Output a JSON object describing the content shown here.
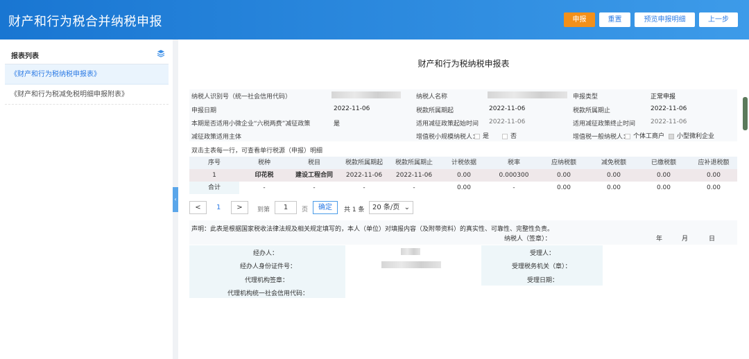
{
  "header": {
    "title": "财产和行为税合并纳税申报",
    "buttons": {
      "declare": "申报",
      "reset": "重置",
      "preview": "预览申报明细",
      "back": "上一步"
    }
  },
  "sidebar": {
    "title": "报表列表",
    "items": [
      "《财产和行为税纳税申报表》",
      "《财产和行为税减免税明细申报附表》"
    ]
  },
  "form": {
    "title": "财产和行为税纳税申报表",
    "taxpayer_id_label": "纳税人识别号（统一社会信用代码）",
    "taxpayer_name_label": "纳税人名称",
    "report_type_label": "申报类型",
    "report_type_value": "正常申报",
    "report_date_label": "申报日期",
    "report_date_value": "2022-11-06",
    "period_start_label": "税款所属期起",
    "period_start_value": "2022-11-06",
    "period_end_label": "税款所属期止",
    "period_end_value": "2022-11-06",
    "six_tax_label": "本期是否适用小微企业“六税两费”减征政策",
    "six_tax_value": "是",
    "policy_start_label": "适用减征政策起始时间",
    "policy_start_value": "2022-11-06",
    "policy_end_label": "适用减征政策终止时间",
    "policy_end_value": "2022-11-06",
    "policy_subject_label": "减征政策适用主体",
    "small_scale_label": "增值税小规模纳税人：",
    "yes": "是",
    "no": "否",
    "general_label": "增值税一般纳税人：",
    "individual": "个体工商户",
    "small_micro": "小型微利企业",
    "hint": "双击主表每一行，可查看单行税源（申报）明细"
  },
  "table": {
    "headers": [
      "序号",
      "税种",
      "税目",
      "税款所属期起",
      "税款所属期止",
      "计税依据",
      "税率",
      "应纳税额",
      "减免税额",
      "已缴税额",
      "应补退税额"
    ],
    "rows": [
      [
        "1",
        "印花税",
        "建设工程合同",
        "2022-11-06",
        "2022-11-06",
        "0.00",
        "0.000300",
        "0.00",
        "0.00",
        "0.00",
        "0.00"
      ]
    ],
    "total": [
      "合计",
      "-",
      "-",
      "-",
      "-",
      "0.00",
      "-",
      "0.00",
      "0.00",
      "0.00",
      "0.00"
    ]
  },
  "pagination": {
    "prev": "<",
    "current": "1",
    "next": ">",
    "goto_label": "到第",
    "goto_value": "1",
    "page_unit": "页",
    "confirm": "确定",
    "total": "共 1 条",
    "page_size": "20 条/页"
  },
  "declaration": {
    "text": "声明：此表是根据国家税收法律法规及相关规定填写的，本人（单位）对填报内容（及附带资料）的真实性、可靠性、完整性负责。",
    "taxpayer_sign": "纳税人（签章）：",
    "year": "年",
    "month": "月",
    "day": "日",
    "agent": "经办人：",
    "agent_id": "经办人身份证件号：",
    "agency_seal": "代理机构签章：",
    "agency_credit": "代理机构统一社会信用代码：",
    "receiver": "受理人：",
    "receiver_org": "受理税务机关（章）：",
    "receive_date": "受理日期："
  },
  "colors": {
    "header_start": "#1976d2",
    "header_end": "#3d9be9",
    "primary_button": "#f39019",
    "accent": "#2c7be5"
  }
}
